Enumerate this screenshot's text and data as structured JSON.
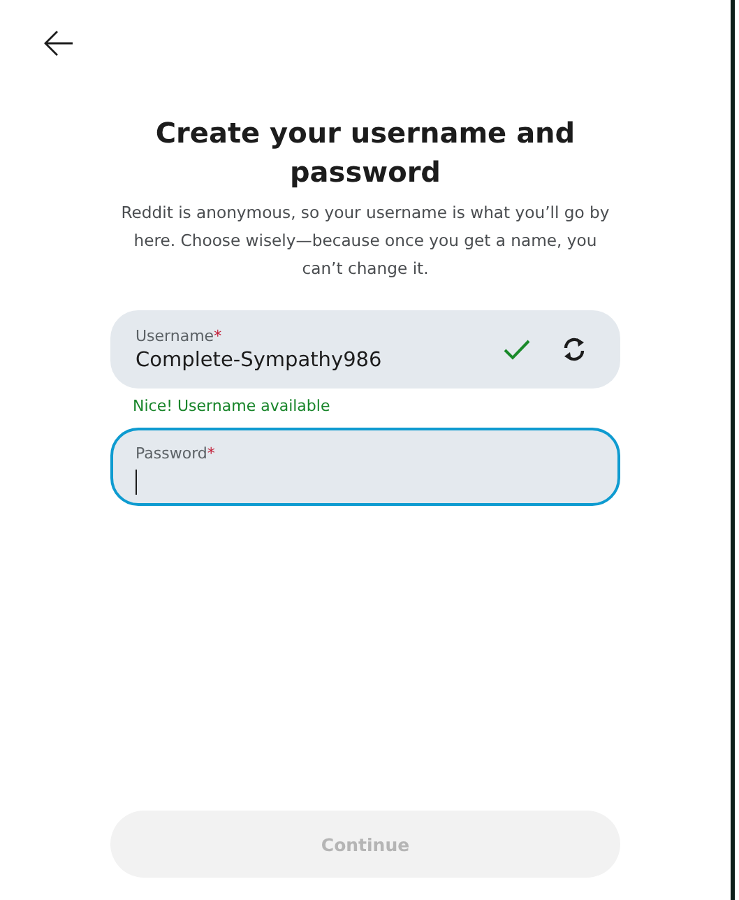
{
  "title": "Create your username and password",
  "description": "Reddit is anonymous, so your username is what you’ll go by here. Choose wisely—because once you get a name, you can’t change it.",
  "fields": [
    {
      "label": "Username",
      "required_mark": "*",
      "value": "Complete-Sympathy986",
      "valid": true,
      "focused": false,
      "has_refresh": true,
      "message": "Nice! Username available"
    },
    {
      "label": "Password",
      "required_mark": "*",
      "valid": false,
      "focused": true,
      "has_refresh": false
    }
  ],
  "continue_button": {
    "label": "Continue",
    "disabled": true
  }
}
